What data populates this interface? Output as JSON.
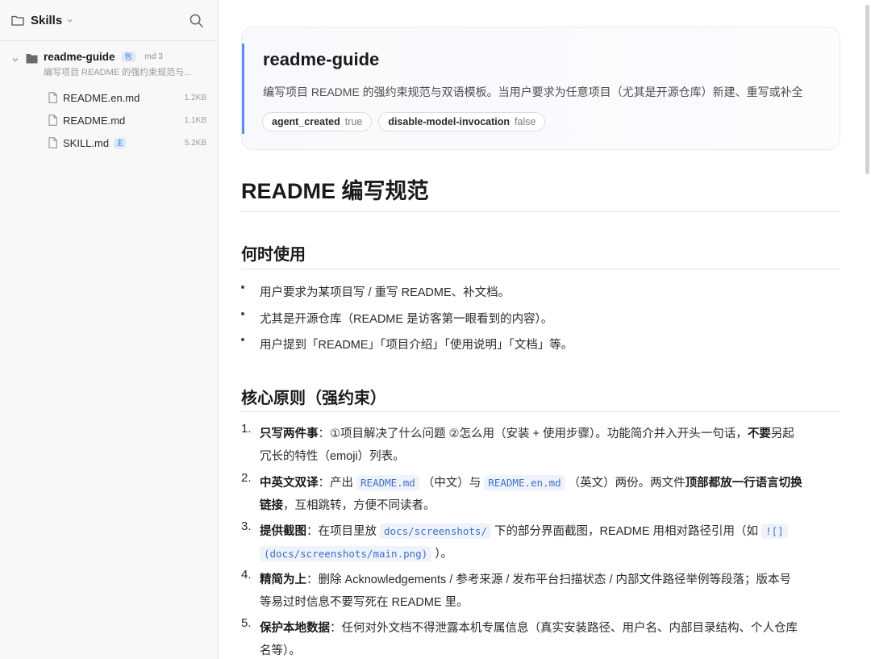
{
  "sidebar": {
    "title": "Skills",
    "tree": {
      "name": "readme-guide",
      "badge": "包",
      "md_count": "md 3",
      "description": "编写项目 README 的强约束规范与...",
      "files": [
        {
          "name": "README.en.md",
          "size": "1.2KB",
          "badge": ""
        },
        {
          "name": "README.md",
          "size": "1.1KB",
          "badge": ""
        },
        {
          "name": "SKILL.md",
          "size": "5.2KB",
          "badge": "主"
        }
      ]
    }
  },
  "card": {
    "title": "readme-guide",
    "description": "编写项目 README 的强约束规范与双语模板。当用户要求为任意项目（尤其是开源仓库）新建、重写或补全",
    "tags": [
      {
        "key": "agent_created",
        "value": "true"
      },
      {
        "key": "disable-model-invocation",
        "value": "false"
      }
    ]
  },
  "doc": {
    "h1": "README 编写规范",
    "section1": {
      "heading": "何时使用",
      "bullets": [
        "用户要求为某项目写 / 重写 README、补文档。",
        "尤其是开源仓库（README 是访客第一眼看到的内容）。",
        "用户提到「README」「项目介绍」「使用说明」「文档」等。"
      ]
    },
    "section2": {
      "heading": "核心原则（强约束）",
      "items": [
        {
          "num": "1.",
          "bold": "只写两件事",
          "line1": "：①项目解决了什么问题 ②怎么用（安装 + 使用步骤）。功能简介并入开头一句话，",
          "bold2": "不要",
          "line1b": "另起",
          "line2": "冗长的特性（emoji）列表。"
        },
        {
          "num": "2.",
          "bold": "中英文双译",
          "pre": "：产出 ",
          "code1": "README.md",
          "mid1": " （中文）与 ",
          "code2": "README.en.md",
          "mid2": " （英文）两份。两文件",
          "bold2": "顶部都放一行语言切换",
          "bold3": "链接",
          "line2": "，互相跳转，方便不同读者。"
        },
        {
          "num": "3.",
          "bold": "提供截图",
          "pre": "：在项目里放 ",
          "code1": "docs/screenshots/",
          "mid1": " 下的部分界面截图，README 用相对路径引用（如 ",
          "code2": "![]",
          "code3": "(docs/screenshots/main.png)",
          "post": " ）。"
        },
        {
          "num": "4.",
          "bold": "精简为上",
          "line1": "：删除 Acknowledgements / 参考来源 / 发布平台扫描状态 / 内部文件路径举例等段落；版本号",
          "line2": "等易过时信息不要写死在 README 里。"
        },
        {
          "num": "5.",
          "bold": "保护本地数据",
          "line1": "：任何对外文档不得泄露本机专属信息（真实安装路径、用户名、内部目录结构、个人仓库",
          "line2": "名等）。"
        }
      ]
    }
  }
}
